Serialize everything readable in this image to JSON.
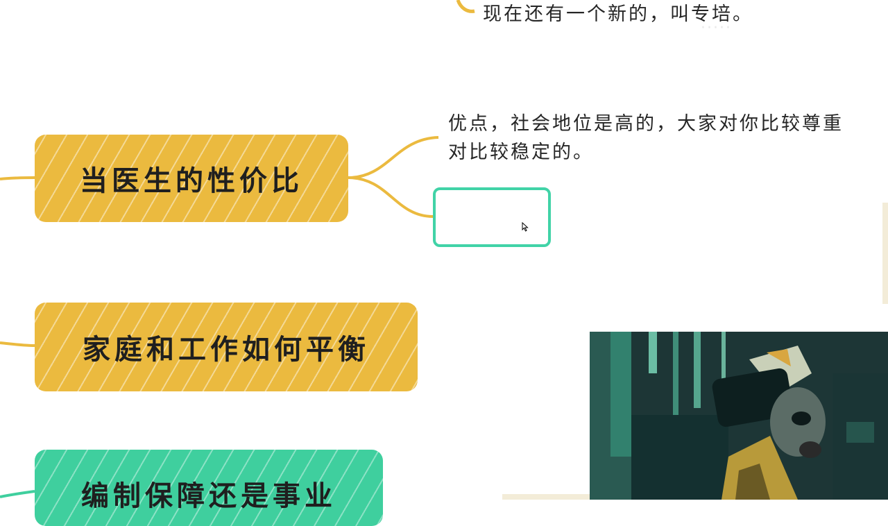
{
  "mindmap": {
    "top_note": "现在还有一个新的，叫专培。",
    "branches": {
      "cost_value": "当医生的性价比",
      "family_work": "家庭和工作如何平衡",
      "bianzhi": "编制保障还是事业"
    },
    "cost_value_children": {
      "advantage_line1": "优点，社会地位是高的，大家对你比较尊重",
      "advantage_line2": "对比较稳定的。",
      "empty_node": ""
    }
  },
  "colors": {
    "branch_yellow": "#ebba3f",
    "branch_green": "#3fcf9e",
    "selection_border": "#41d3a7",
    "connector": "#ebba3f"
  },
  "icons": {
    "cursor": "mouse-pointer-icon",
    "video": "video-overlay"
  }
}
